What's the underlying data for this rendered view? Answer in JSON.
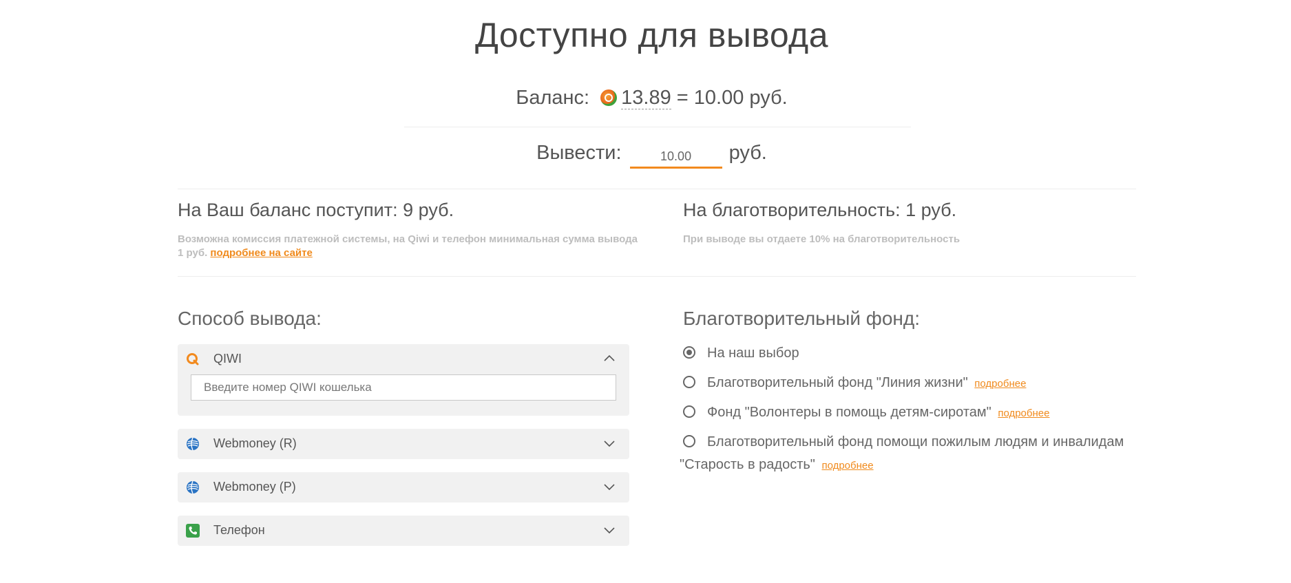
{
  "header": {
    "title": "Доступно для вывода"
  },
  "balance": {
    "label": "Баланс:",
    "coin_amount": "13.89",
    "equals_text": "= 10.00 руб."
  },
  "withdraw": {
    "label": "Вывести:",
    "amount": "10.00",
    "currency": "руб."
  },
  "summary": {
    "balance_title": "На Ваш баланс поступит: 9 руб.",
    "balance_note": "Возможна комиссия платежной системы, на Qiwi и телефон минимальная сумма вывода 1 руб.",
    "balance_note_link": "подробнее на сайте",
    "charity_title": "На благотворительность: 1 руб.",
    "charity_note": "При выводе вы отдаете 10% на благотворительность"
  },
  "methods": {
    "title": "Способ вывода:",
    "items": [
      {
        "label": "QIWI",
        "icon": "qiwi-icon",
        "expanded": true
      },
      {
        "label": "Webmoney (R)",
        "icon": "webmoney-icon",
        "expanded": false
      },
      {
        "label": "Webmoney (P)",
        "icon": "webmoney-icon",
        "expanded": false
      },
      {
        "label": "Телефон",
        "icon": "phone-icon",
        "expanded": false
      }
    ],
    "qiwi_placeholder": "Введите номер QIWI кошелька"
  },
  "funds": {
    "title": "Благотворительный фонд:",
    "more_label": "подробнее",
    "options": [
      {
        "label": "На наш выбор",
        "selected": true
      },
      {
        "label": "Благотворительный фонд \"Линия жизни\"",
        "selected": false
      },
      {
        "label": "Фонд \"Волонтеры в помощь детям-сиротам\"",
        "selected": false
      },
      {
        "label_line1": "Благотворительный фонд помощи пожилым людям и инвалидам",
        "label_line2": "\"Старость в радость\"",
        "selected": false
      }
    ]
  },
  "colors": {
    "accent": "#f28a1e",
    "panel": "#f1f1f1",
    "muted_text": "#bdbdbd"
  }
}
